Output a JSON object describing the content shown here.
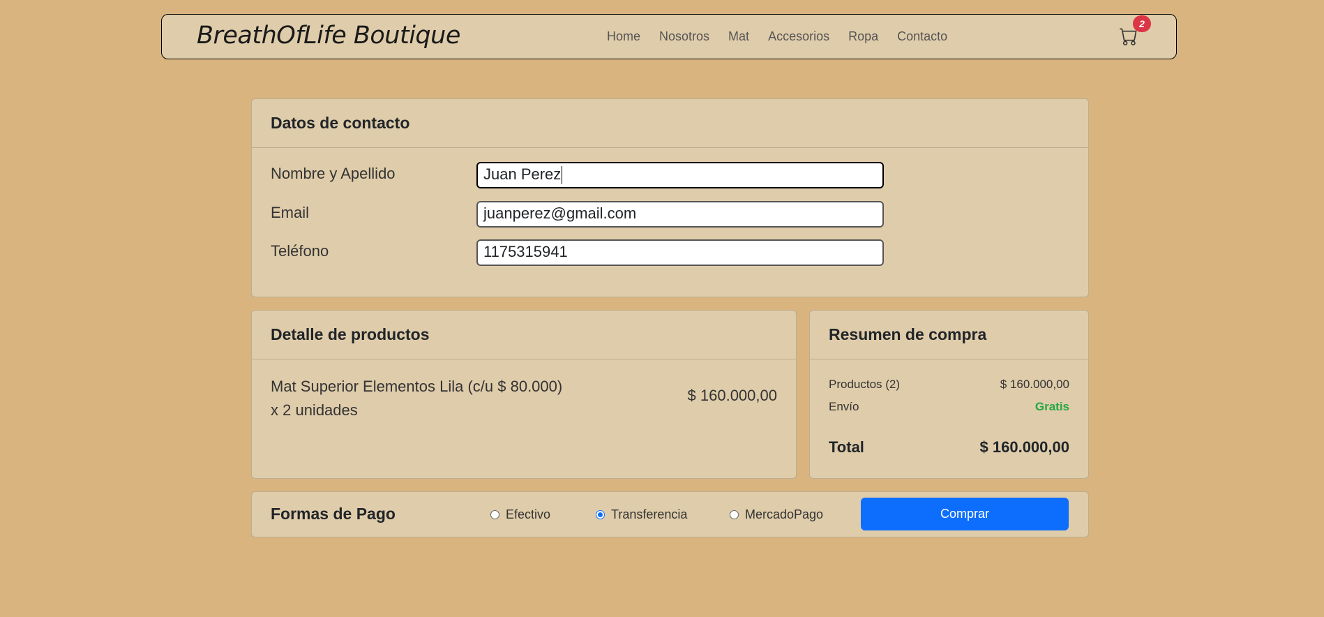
{
  "navbar": {
    "brand": "BreathOfLife Boutique",
    "links": [
      "Home",
      "Nosotros",
      "Mat",
      "Accesorios",
      "Ropa",
      "Contacto"
    ],
    "cart_count": "2"
  },
  "contact": {
    "title": "Datos de contacto",
    "name_label": "Nombre y Apellido",
    "name_value": "Juan Perez",
    "email_label": "Email",
    "email_value": "juanperez@gmail.com",
    "phone_label": "Teléfono",
    "phone_value": "1175315941"
  },
  "products": {
    "title": "Detalle de productos",
    "items": [
      {
        "name": "Mat Superior Elementos Lila (c/u $ 80.000)",
        "qty": "x 2 unidades",
        "total": "$ 160.000,00"
      }
    ]
  },
  "summary": {
    "title": "Resumen de compra",
    "products_label": "Productos (2)",
    "products_value": "$ 160.000,00",
    "shipping_label": "Envío",
    "shipping_value": "Gratis",
    "total_label": "Total",
    "total_value": "$ 160.000,00"
  },
  "payment": {
    "title": "Formas de Pago",
    "options": [
      "Efectivo",
      "Transferencia",
      "MercadoPago"
    ],
    "selected": "Transferencia",
    "buy_label": "Comprar"
  },
  "colors": {
    "background": "#d9b47f",
    "card": "#dfccaa",
    "primary": "#0d6efd",
    "badge": "#dc3545",
    "success": "#28a745"
  }
}
